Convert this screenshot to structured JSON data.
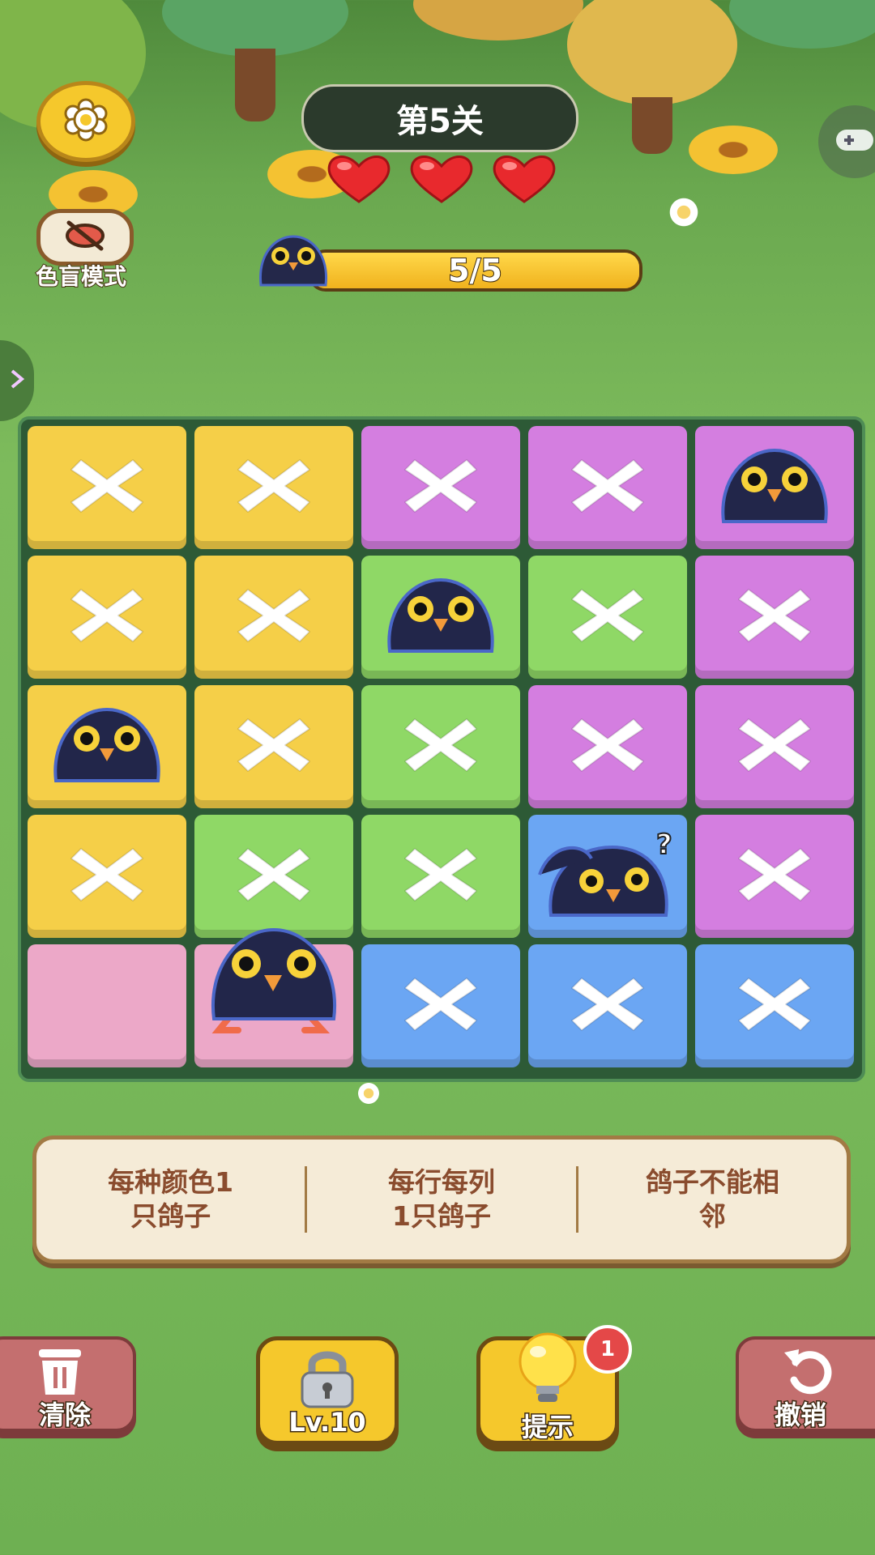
{
  "header": {
    "level_title": "第5关",
    "lives": 3,
    "progress_text": "5/5",
    "progress_fraction": 1.0
  },
  "colorblind": {
    "label": "色盲模式"
  },
  "board": {
    "rows": [
      [
        {
          "color": "yellow",
          "state": "x"
        },
        {
          "color": "yellow",
          "state": "x"
        },
        {
          "color": "purple",
          "state": "x"
        },
        {
          "color": "purple",
          "state": "x"
        },
        {
          "color": "purple",
          "state": "pigeon"
        }
      ],
      [
        {
          "color": "yellow",
          "state": "x"
        },
        {
          "color": "yellow",
          "state": "x"
        },
        {
          "color": "green",
          "state": "pigeon"
        },
        {
          "color": "green",
          "state": "x"
        },
        {
          "color": "purple",
          "state": "x"
        }
      ],
      [
        {
          "color": "yellow",
          "state": "pigeon"
        },
        {
          "color": "yellow",
          "state": "x"
        },
        {
          "color": "green",
          "state": "x"
        },
        {
          "color": "purple",
          "state": "x"
        },
        {
          "color": "purple",
          "state": "x"
        }
      ],
      [
        {
          "color": "yellow",
          "state": "x"
        },
        {
          "color": "green",
          "state": "x"
        },
        {
          "color": "green",
          "state": "x"
        },
        {
          "color": "blue",
          "state": "pigeon-confused"
        },
        {
          "color": "purple",
          "state": "x"
        }
      ],
      [
        {
          "color": "pink",
          "state": "empty"
        },
        {
          "color": "pink",
          "state": "pigeon-standing"
        },
        {
          "color": "blue",
          "state": "x"
        },
        {
          "color": "blue",
          "state": "x"
        },
        {
          "color": "blue",
          "state": "x"
        }
      ]
    ],
    "colors": {
      "yellow": "#f5cf48",
      "purple": "#d47ee0",
      "green": "#8fd866",
      "blue": "#6ba6f3",
      "pink": "#eca8c8"
    }
  },
  "rules": {
    "rule1_line1": "每种颜色1",
    "rule1_line2": "只鸽子",
    "rule2_line1": "每行每列",
    "rule2_line2": "1只鸽子",
    "rule3_line1": "鸽子不能相",
    "rule3_line2": "邻"
  },
  "toolbar": {
    "clear_label": "清除",
    "lock_label": "Lv.10",
    "hint_label": "提示",
    "hint_badge": "1",
    "undo_label": "撤销"
  },
  "icons": {
    "settings": "gear-icon",
    "colorblind": "eye-slash-icon",
    "gamepad": "gamepad-icon",
    "heart": "heart-icon",
    "clear": "trash-icon",
    "lock": "lock-icon",
    "hint": "lightbulb-icon",
    "undo": "undo-icon"
  }
}
